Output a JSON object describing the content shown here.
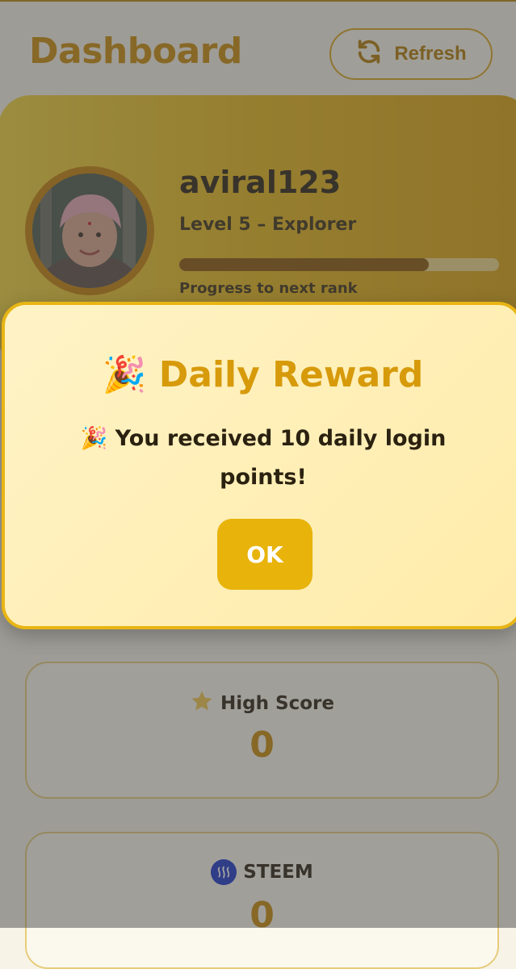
{
  "header": {
    "title": "Dashboard",
    "refresh_label": "Refresh",
    "refresh_icon": "refresh-icon"
  },
  "profile": {
    "username": "aviral123",
    "level": "Level 5 – Explorer",
    "progress_label": "Progress to next rank",
    "progress_fraction": 0.78
  },
  "stats": [
    {
      "label": "High Score",
      "value": "0",
      "icon": "star-icon"
    },
    {
      "label": "STEEM",
      "value": "0",
      "icon": "steem-icon"
    }
  ],
  "modal": {
    "title_emoji": "🎉",
    "title": "Daily Reward",
    "message_emoji": "🎉",
    "message": "You received 10 daily login points!",
    "ok_label": "OK"
  },
  "colors": {
    "accent": "#c98b07",
    "card_gold": "#e7b81a",
    "ok_button": "#e8b30b",
    "steem_blue": "#1a35c9"
  }
}
